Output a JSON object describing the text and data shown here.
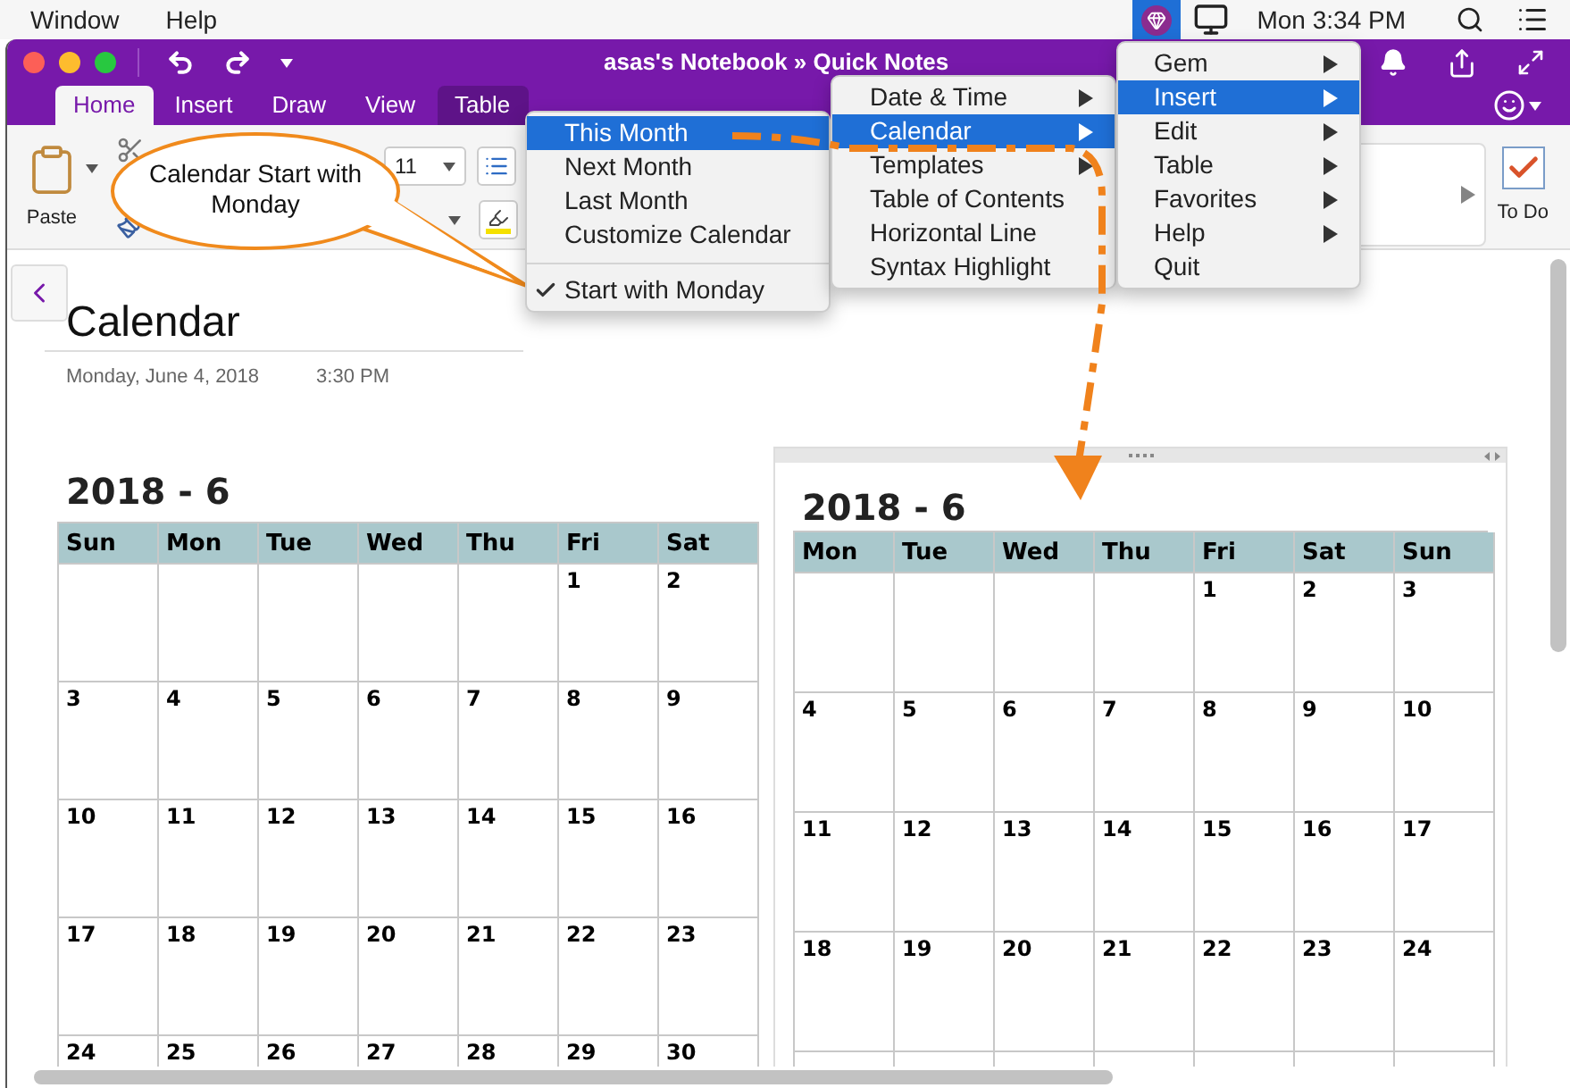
{
  "menubar": {
    "items": [
      "Window",
      "Help"
    ],
    "clock": "Mon 3:34 PM"
  },
  "window": {
    "title": "asas's Notebook » Quick Notes"
  },
  "tabs": [
    {
      "label": "Home",
      "selected": true,
      "highlighted": false
    },
    {
      "label": "Insert",
      "selected": false,
      "highlighted": false
    },
    {
      "label": "Draw",
      "selected": false,
      "highlighted": false
    },
    {
      "label": "View",
      "selected": false,
      "highlighted": false
    },
    {
      "label": "Table",
      "selected": false,
      "highlighted": true
    }
  ],
  "ribbon": {
    "paste": "Paste",
    "font_size": "11",
    "todo": "To Do",
    "todo_checked": true
  },
  "page": {
    "title": "Calendar",
    "date": "Monday, June 4, 2018",
    "time": "3:30 PM"
  },
  "calendars": [
    {
      "title": "2018 - 6",
      "days": [
        "Sun",
        "Mon",
        "Tue",
        "Wed",
        "Thu",
        "Fri",
        "Sat"
      ],
      "weeks": [
        [
          {
            "kind": "blank"
          },
          {
            "kind": "blank"
          },
          {
            "kind": "blank"
          },
          {
            "kind": "blank"
          },
          {
            "kind": "blank"
          },
          {
            "kind": "date",
            "day": "1"
          },
          {
            "kind": "date",
            "day": "2"
          }
        ],
        [
          {
            "kind": "date",
            "day": "3"
          },
          {
            "kind": "date",
            "day": "4"
          },
          {
            "kind": "date",
            "day": "5"
          },
          {
            "kind": "date",
            "day": "6"
          },
          {
            "kind": "date",
            "day": "7"
          },
          {
            "kind": "date",
            "day": "8"
          },
          {
            "kind": "date",
            "day": "9"
          }
        ],
        [
          {
            "kind": "date",
            "day": "10"
          },
          {
            "kind": "date",
            "day": "11"
          },
          {
            "kind": "date",
            "day": "12"
          },
          {
            "kind": "date",
            "day": "13"
          },
          {
            "kind": "date",
            "day": "14"
          },
          {
            "kind": "date",
            "day": "15"
          },
          {
            "kind": "date",
            "day": "16"
          }
        ],
        [
          {
            "kind": "date",
            "day": "17"
          },
          {
            "kind": "date",
            "day": "18"
          },
          {
            "kind": "date",
            "day": "19"
          },
          {
            "kind": "date",
            "day": "20"
          },
          {
            "kind": "date",
            "day": "21"
          },
          {
            "kind": "date",
            "day": "22"
          },
          {
            "kind": "date",
            "day": "23"
          }
        ],
        [
          {
            "kind": "date",
            "day": "24"
          },
          {
            "kind": "date",
            "day": "25"
          },
          {
            "kind": "date",
            "day": "26"
          },
          {
            "kind": "date",
            "day": "27"
          },
          {
            "kind": "date",
            "day": "28"
          },
          {
            "kind": "date",
            "day": "29"
          },
          {
            "kind": "date",
            "day": "30"
          }
        ]
      ]
    },
    {
      "title": "2018 - 6",
      "days": [
        "Mon",
        "Tue",
        "Wed",
        "Thu",
        "Fri",
        "Sat",
        "Sun"
      ],
      "weeks": [
        [
          {
            "kind": "blank"
          },
          {
            "kind": "blank"
          },
          {
            "kind": "blank"
          },
          {
            "kind": "blank"
          },
          {
            "kind": "date",
            "day": "1"
          },
          {
            "kind": "date",
            "day": "2"
          },
          {
            "kind": "date",
            "day": "3"
          }
        ],
        [
          {
            "kind": "date",
            "day": "4"
          },
          {
            "kind": "date",
            "day": "5"
          },
          {
            "kind": "date",
            "day": "6"
          },
          {
            "kind": "date",
            "day": "7"
          },
          {
            "kind": "date",
            "day": "8"
          },
          {
            "kind": "date",
            "day": "9"
          },
          {
            "kind": "date",
            "day": "10"
          }
        ],
        [
          {
            "kind": "date",
            "day": "11"
          },
          {
            "kind": "date",
            "day": "12"
          },
          {
            "kind": "date",
            "day": "13"
          },
          {
            "kind": "date",
            "day": "14"
          },
          {
            "kind": "date",
            "day": "15"
          },
          {
            "kind": "date",
            "day": "16"
          },
          {
            "kind": "date",
            "day": "17"
          }
        ],
        [
          {
            "kind": "date",
            "day": "18"
          },
          {
            "kind": "date",
            "day": "19"
          },
          {
            "kind": "date",
            "day": "20"
          },
          {
            "kind": "date",
            "day": "21"
          },
          {
            "kind": "date",
            "day": "22"
          },
          {
            "kind": "date",
            "day": "23"
          },
          {
            "kind": "date",
            "day": "24"
          }
        ],
        [
          {
            "kind": "blank"
          },
          {
            "kind": "blank"
          },
          {
            "kind": "blank"
          },
          {
            "kind": "blank"
          },
          {
            "kind": "blank"
          },
          {
            "kind": "blank"
          },
          {
            "kind": "blank"
          }
        ]
      ]
    }
  ],
  "menus": [
    {
      "items": [
        {
          "kind": "item",
          "label": "This Month",
          "selected": true,
          "checked": false,
          "submenu": false
        },
        {
          "kind": "item",
          "label": "Next Month",
          "selected": false,
          "checked": false,
          "submenu": false
        },
        {
          "kind": "item",
          "label": "Last Month",
          "selected": false,
          "checked": false,
          "submenu": false
        },
        {
          "kind": "item",
          "label": "Customize Calendar",
          "selected": false,
          "checked": false,
          "submenu": false
        },
        {
          "kind": "separator"
        },
        {
          "kind": "item",
          "label": "Start with Monday",
          "selected": false,
          "checked": true,
          "submenu": false
        }
      ]
    },
    {
      "items": [
        {
          "kind": "item",
          "label": "Date & Time",
          "selected": false,
          "checked": false,
          "submenu": true
        },
        {
          "kind": "item",
          "label": "Calendar",
          "selected": true,
          "checked": false,
          "submenu": true
        },
        {
          "kind": "item",
          "label": "Templates",
          "selected": false,
          "checked": false,
          "submenu": true
        },
        {
          "kind": "item",
          "label": "Table of Contents",
          "selected": false,
          "checked": false,
          "submenu": false
        },
        {
          "kind": "item",
          "label": "Horizontal Line",
          "selected": false,
          "checked": false,
          "submenu": false
        },
        {
          "kind": "item",
          "label": "Syntax Highlight",
          "selected": false,
          "checked": false,
          "submenu": false
        }
      ]
    },
    {
      "items": [
        {
          "kind": "item",
          "label": "Gem",
          "selected": false,
          "checked": false,
          "submenu": true
        },
        {
          "kind": "item",
          "label": "Insert",
          "selected": true,
          "checked": false,
          "submenu": true
        },
        {
          "kind": "item",
          "label": "Edit",
          "selected": false,
          "checked": false,
          "submenu": true
        },
        {
          "kind": "item",
          "label": "Table",
          "selected": false,
          "checked": false,
          "submenu": true
        },
        {
          "kind": "item",
          "label": "Favorites",
          "selected": false,
          "checked": false,
          "submenu": true
        },
        {
          "kind": "item",
          "label": "Help",
          "selected": false,
          "checked": false,
          "submenu": true
        },
        {
          "kind": "item",
          "label": "Quit",
          "selected": false,
          "checked": false,
          "submenu": false
        }
      ]
    }
  ],
  "callout": {
    "text": "Calendar Start with Monday"
  }
}
